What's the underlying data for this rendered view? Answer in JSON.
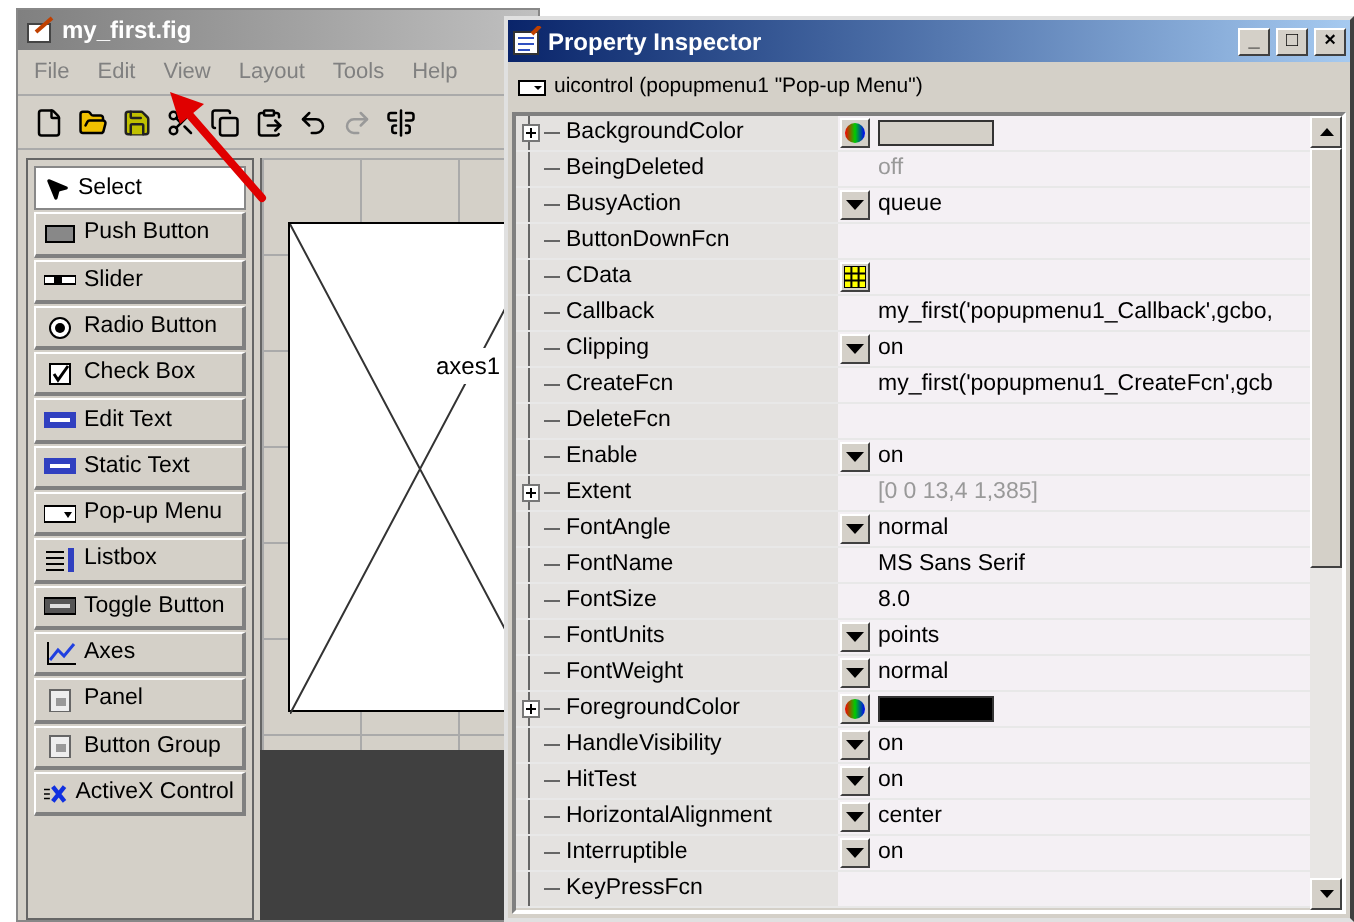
{
  "guide_window": {
    "title": "my_first.fig",
    "menu": [
      "File",
      "Edit",
      "View",
      "Layout",
      "Tools",
      "Help"
    ],
    "palette": [
      {
        "label": "Select",
        "selected": true
      },
      {
        "label": "Push Button",
        "selected": false
      },
      {
        "label": "Slider",
        "selected": false
      },
      {
        "label": "Radio Button",
        "selected": false
      },
      {
        "label": "Check Box",
        "selected": false
      },
      {
        "label": "Edit Text",
        "selected": false
      },
      {
        "label": "Static Text",
        "selected": false
      },
      {
        "label": "Pop-up Menu",
        "selected": false
      },
      {
        "label": "Listbox",
        "selected": false
      },
      {
        "label": "Toggle Button",
        "selected": false
      },
      {
        "label": "Axes",
        "selected": false
      },
      {
        "label": "Panel",
        "selected": false
      },
      {
        "label": "Button Group",
        "selected": false
      },
      {
        "label": "ActiveX Control",
        "selected": false
      }
    ],
    "canvas": {
      "axes_label": "axes1"
    }
  },
  "property_inspector": {
    "title": "Property Inspector",
    "window_buttons": [
      "_",
      "□",
      "×"
    ],
    "object": "uicontrol (popupmenu1 \"Pop-up Menu\")",
    "properties": [
      {
        "name": "BackgroundColor",
        "expandable": true,
        "kind": "color",
        "color": "#d4d0c8"
      },
      {
        "name": "BeingDeleted",
        "expandable": false,
        "kind": "readonly",
        "value": "off"
      },
      {
        "name": "BusyAction",
        "expandable": false,
        "kind": "dropdown",
        "value": "queue"
      },
      {
        "name": "ButtonDownFcn",
        "expandable": false,
        "kind": "text"
      },
      {
        "name": "CData",
        "expandable": false,
        "kind": "grid"
      },
      {
        "name": "Callback",
        "expandable": false,
        "kind": "text",
        "value": "my_first('popupmenu1_Callback',gcbo,"
      },
      {
        "name": "Clipping",
        "expandable": false,
        "kind": "dropdown",
        "value": "on"
      },
      {
        "name": "CreateFcn",
        "expandable": false,
        "kind": "text",
        "value": "my_first('popupmenu1_CreateFcn',gcb"
      },
      {
        "name": "DeleteFcn",
        "expandable": false,
        "kind": "text"
      },
      {
        "name": "Enable",
        "expandable": false,
        "kind": "dropdown",
        "value": "on"
      },
      {
        "name": "Extent",
        "expandable": true,
        "kind": "readonly",
        "value": "[0 0 13,4 1,385]"
      },
      {
        "name": "FontAngle",
        "expandable": false,
        "kind": "dropdown",
        "value": "normal"
      },
      {
        "name": "FontName",
        "expandable": false,
        "kind": "text",
        "value": "MS Sans Serif"
      },
      {
        "name": "FontSize",
        "expandable": false,
        "kind": "text",
        "value": "8.0"
      },
      {
        "name": "FontUnits",
        "expandable": false,
        "kind": "dropdown",
        "value": "points"
      },
      {
        "name": "FontWeight",
        "expandable": false,
        "kind": "dropdown",
        "value": "normal"
      },
      {
        "name": "ForegroundColor",
        "expandable": true,
        "kind": "color",
        "color": "#000000"
      },
      {
        "name": "HandleVisibility",
        "expandable": false,
        "kind": "dropdown",
        "value": "on"
      },
      {
        "name": "HitTest",
        "expandable": false,
        "kind": "dropdown",
        "value": "on"
      },
      {
        "name": "HorizontalAlignment",
        "expandable": false,
        "kind": "dropdown",
        "value": "center"
      },
      {
        "name": "Interruptible",
        "expandable": false,
        "kind": "dropdown",
        "value": "on"
      },
      {
        "name": "KeyPressFcn",
        "expandable": false,
        "kind": "text"
      }
    ]
  }
}
